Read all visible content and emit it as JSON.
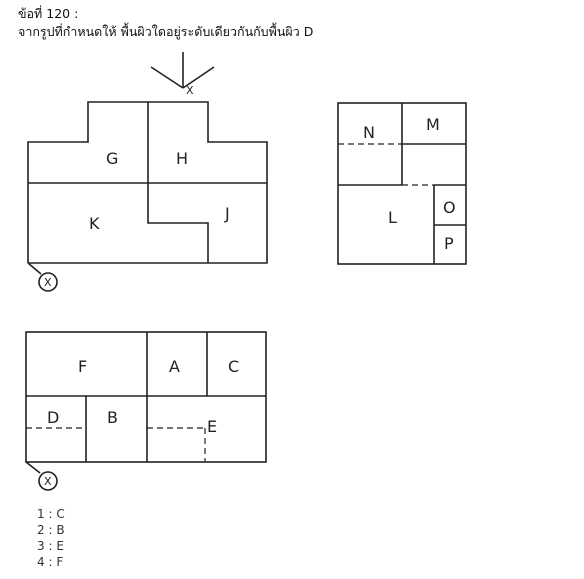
{
  "question": {
    "number_label": "ข้อที่ 120 :",
    "text": "จากรูปที่กำหนดให้ พื้นผิวใดอยู่ระดับเดียวกันกับพื้นผิว D"
  },
  "figures": {
    "top_view_labels": [
      "G",
      "H",
      "K",
      "J"
    ],
    "top_view_arrow_label": "X",
    "side_view_labels": [
      "N",
      "M",
      "L",
      "O",
      "P"
    ],
    "front_view_labels": [
      "F",
      "A",
      "C",
      "D",
      "B",
      "E"
    ],
    "circle_marker_label": "X"
  },
  "choices": [
    {
      "number": "1",
      "value": "C"
    },
    {
      "number": "2",
      "value": "B"
    },
    {
      "number": "3",
      "value": "E"
    },
    {
      "number": "4",
      "value": "F"
    }
  ]
}
